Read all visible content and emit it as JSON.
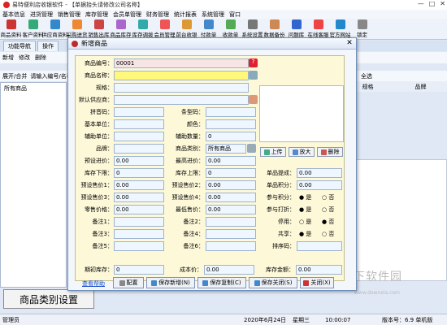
{
  "app": {
    "title": "易特便利店收银软件 - 【单据抬头请修改公司名称】",
    "window_controls": [
      "—",
      "□",
      "✕"
    ]
  },
  "menu": [
    "基本信息",
    "进货管理",
    "销售管理",
    "库存管理",
    "会员单管理",
    "财务管理",
    "统计报表",
    "系统管理",
    "窗口"
  ],
  "toolbar": [
    {
      "label": "商品资料",
      "color": "#c33"
    },
    {
      "label": "客户资料",
      "color": "#3a7"
    },
    {
      "label": "供应商资料",
      "color": "#38c"
    },
    {
      "label": "采购进货",
      "color": "#e83"
    },
    {
      "label": "销售出库",
      "color": "#c44"
    },
    {
      "label": "商品库存",
      "color": "#a6c"
    },
    {
      "label": "库存调拨",
      "color": "#3aa"
    },
    {
      "label": "会员管理",
      "color": "#e55"
    },
    {
      "label": "前台收银",
      "color": "#d93"
    },
    {
      "label": "付款单",
      "color": "#48c"
    },
    {
      "label": "收款单",
      "color": "#5a5"
    },
    {
      "label": "系统设置",
      "color": "#777"
    },
    {
      "label": "数据备份",
      "color": "#c85"
    },
    {
      "label": "问题库",
      "color": "#36c"
    },
    {
      "label": "在线客服",
      "color": "#e44"
    },
    {
      "label": "官方网站",
      "color": "#28c"
    },
    {
      "label": "锁定",
      "color": "#888"
    }
  ],
  "tabs": [
    "功能导航",
    "操作"
  ],
  "subbar": [
    "新增",
    "修改",
    "删除"
  ],
  "subbar2": {
    "expand": "展开/合并",
    "search": "请输入编号/名称",
    "checkbox": "全选"
  },
  "tree": {
    "root": "所有商品"
  },
  "category_button": "商品类别设置",
  "grid_header": [
    "规格",
    "品牌"
  ],
  "status": {
    "user": "管理员",
    "date": "2020年6月24日",
    "weekday": "星期三",
    "time": "10:00:07",
    "version": "版本号：6.9 单机版"
  },
  "watermark": {
    "main": "当下软件园",
    "sub": "www.downxia.com"
  },
  "dialog": {
    "title": "新增商品",
    "close": "✕",
    "fields": {
      "code": {
        "label": "商品编号：",
        "value": "00001"
      },
      "name": {
        "label": "商品名称：",
        "value": ""
      },
      "spec": {
        "label": "规格：",
        "value": ""
      },
      "supplier": {
        "label": "默认供应商：",
        "value": ""
      },
      "pinyin": {
        "label": "拼音码：",
        "value": ""
      },
      "barcode": {
        "label": "条型码：",
        "value": ""
      },
      "unit": {
        "label": "基本单位：",
        "value": ""
      },
      "color": {
        "label": "颜色：",
        "value": ""
      },
      "aux_unit": {
        "label": "辅助单位：",
        "value": ""
      },
      "aux_qty": {
        "label": "辅助数量：",
        "value": "0"
      },
      "brand": {
        "label": "品牌：",
        "value": ""
      },
      "category": {
        "label": "商品类别：",
        "value": "所有商品"
      },
      "pre_buy": {
        "label": "预设进价：",
        "value": "0.00"
      },
      "max_buy": {
        "label": "最高进价：",
        "value": "0.00"
      },
      "stock_low": {
        "label": "库存下限：",
        "value": "0"
      },
      "stock_high": {
        "label": "库存上限：",
        "value": "0"
      },
      "price1": {
        "label": "预设售价1：",
        "value": "0.00"
      },
      "price2": {
        "label": "预设售价2：",
        "value": "0.00"
      },
      "price3": {
        "label": "预设售价3：",
        "value": "0.00"
      },
      "price4": {
        "label": "预设售价4：",
        "value": "0.00"
      },
      "retail": {
        "label": "零售价格：",
        "value": "0.00"
      },
      "min_sale": {
        "label": "最低售价：",
        "value": "0.00"
      },
      "note1": {
        "label": "备注1：",
        "value": ""
      },
      "note2": {
        "label": "备注2：",
        "value": ""
      },
      "note3": {
        "label": "备注3：",
        "value": ""
      },
      "note4": {
        "label": "备注4：",
        "value": ""
      },
      "note5": {
        "label": "备注5：",
        "value": ""
      },
      "note6": {
        "label": "备注6：",
        "value": ""
      },
      "commission": {
        "label": "单品提成：",
        "value": "0.00"
      },
      "points": {
        "label": "单品积分：",
        "value": "0.00"
      },
      "order": {
        "label": "排序码：",
        "value": ""
      }
    },
    "radios": [
      {
        "label": "参与积分：",
        "yes": "是",
        "no": "否",
        "selected": "yes"
      },
      {
        "label": "参与打折：",
        "yes": "是",
        "no": "否",
        "selected": "yes"
      },
      {
        "label": "停用：",
        "yes": "是",
        "no": "否",
        "selected": "no"
      },
      {
        "label": "共享：",
        "yes": "是",
        "no": "否",
        "selected": "yes"
      }
    ],
    "image_buttons": {
      "upload": "上传",
      "zoom": "放大",
      "delete": "删除"
    },
    "footer": {
      "opening_stock_label": "期初库存：",
      "opening_stock_value": "0",
      "cost_label": "成本价：",
      "cost_value": "0.00",
      "amount_label": "库存金额：",
      "amount_value": "0.00",
      "help": "查看帮助",
      "config": "配置",
      "save_new": "保存新增(N)",
      "save_copy": "保存复制(C)",
      "save_close": "保存关闭(S)",
      "close": "关闭(X)"
    }
  }
}
